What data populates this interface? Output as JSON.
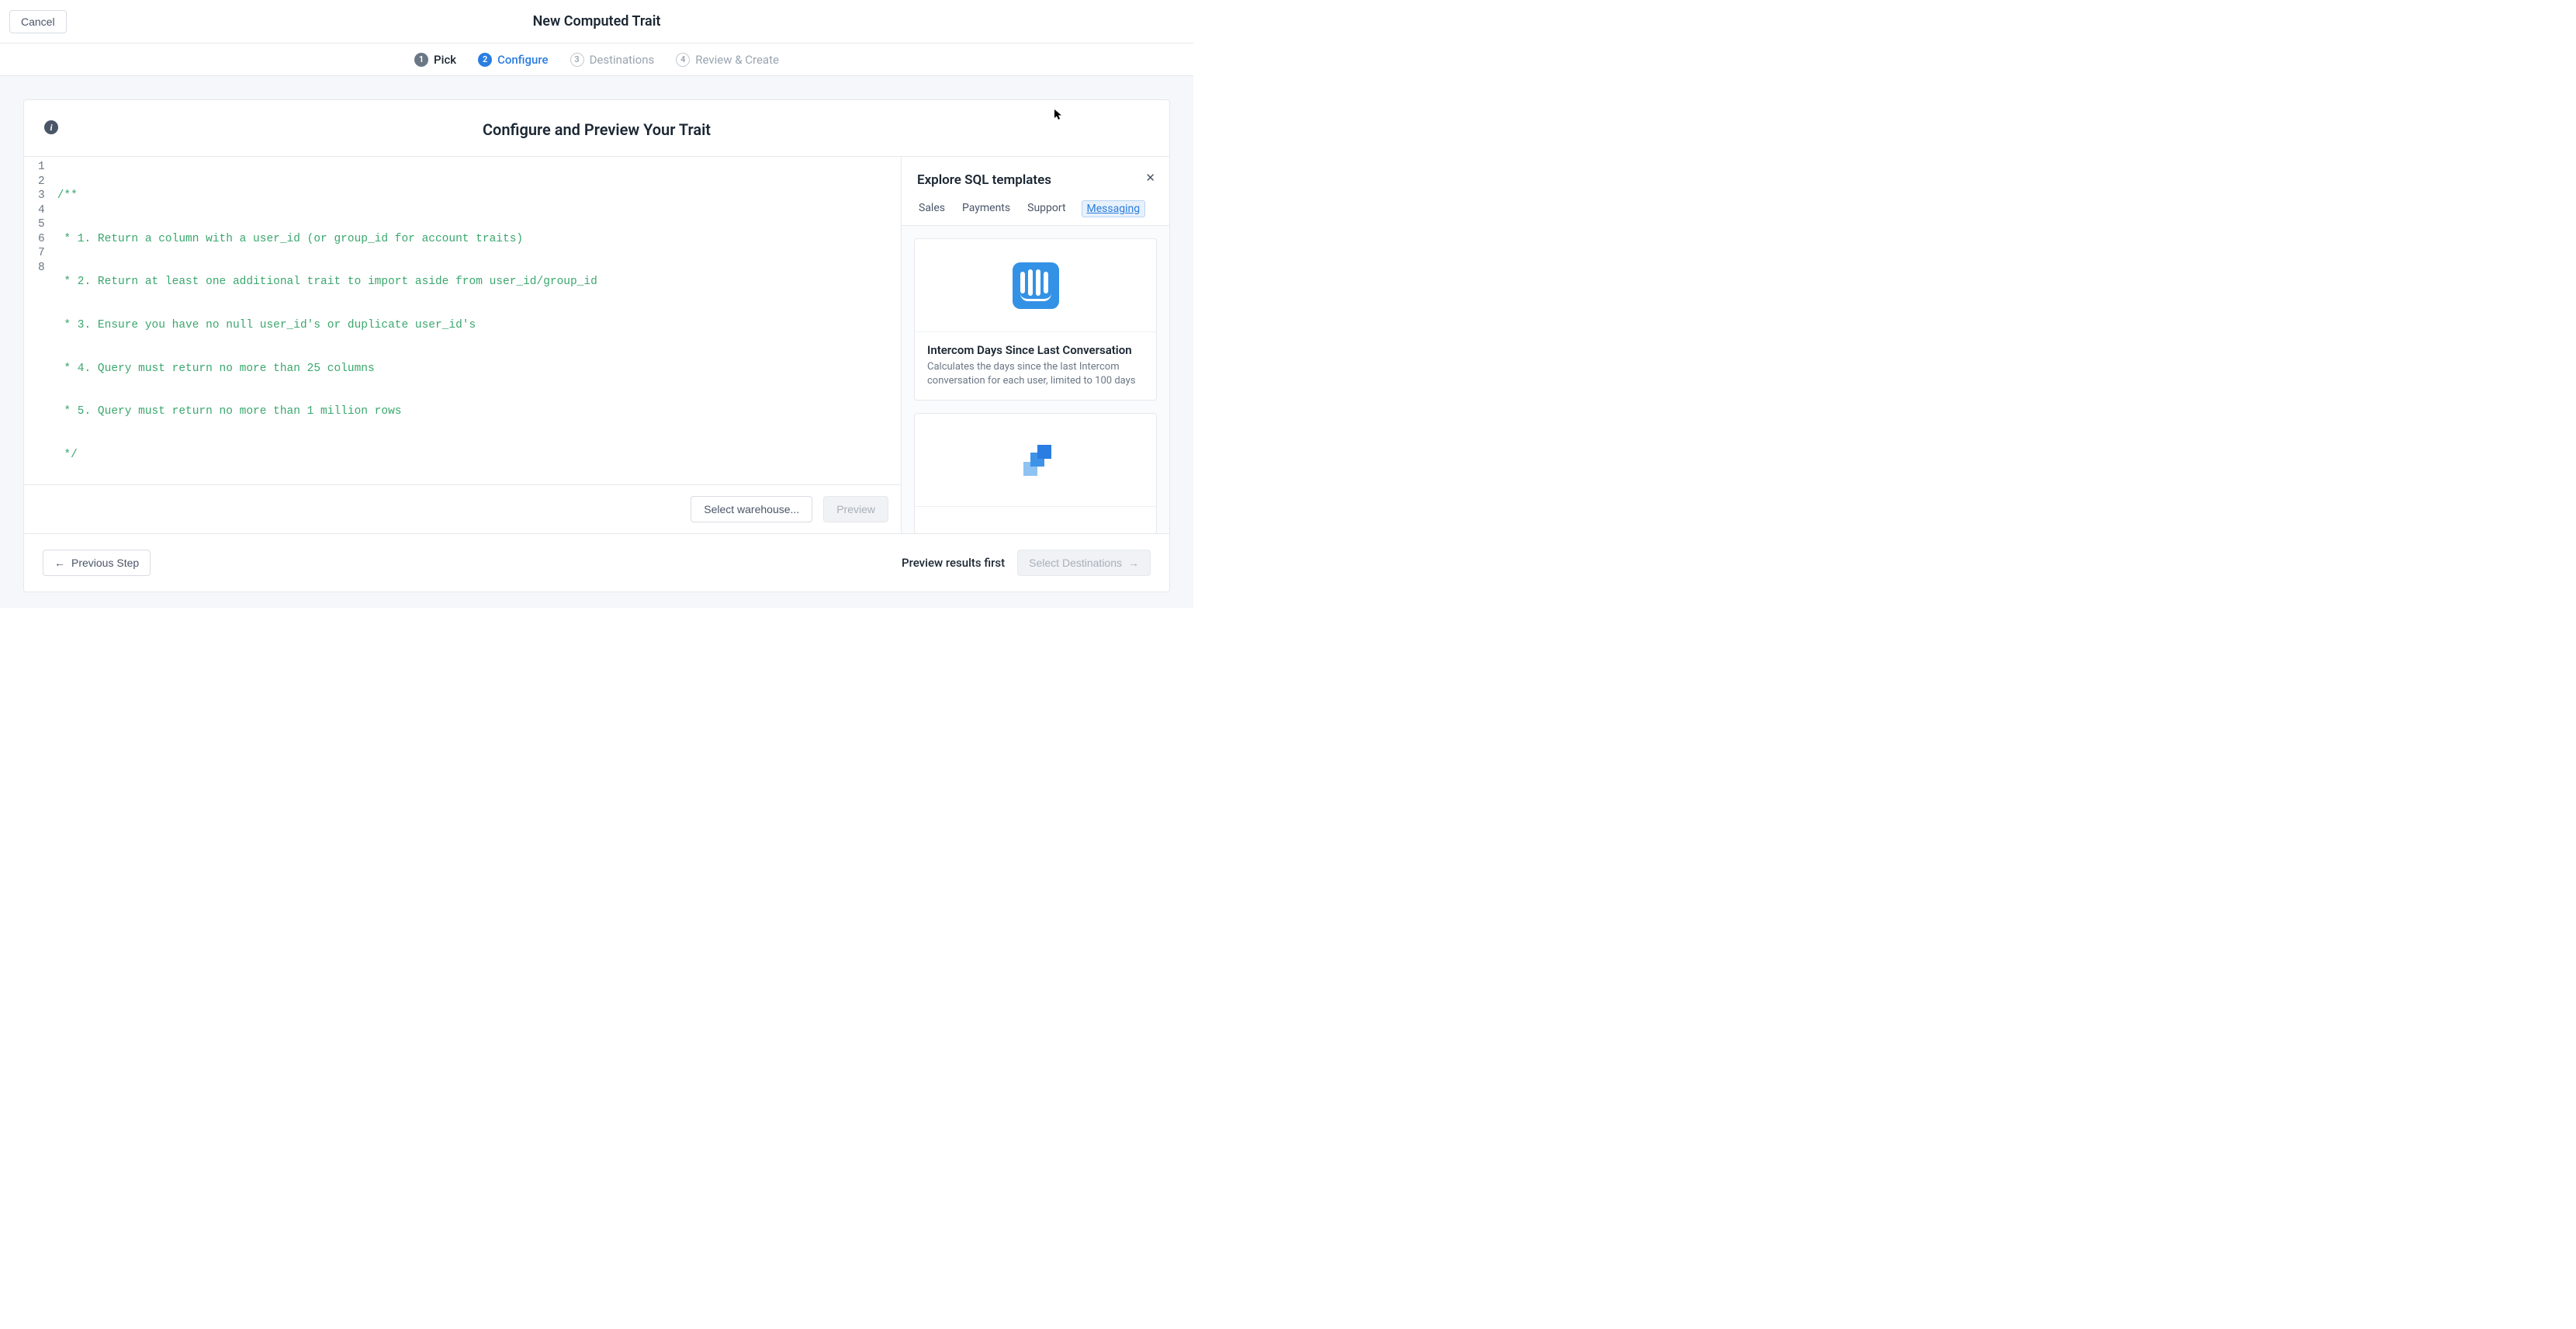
{
  "header": {
    "cancel_label": "Cancel",
    "title": "New Computed Trait"
  },
  "stepper": {
    "steps": [
      {
        "num": "1",
        "label": "Pick",
        "state": "done"
      },
      {
        "num": "2",
        "label": "Configure",
        "state": "active"
      },
      {
        "num": "3",
        "label": "Destinations",
        "state": "future"
      },
      {
        "num": "4",
        "label": "Review & Create",
        "state": "future"
      }
    ]
  },
  "panel": {
    "title": "Configure and Preview Your Trait",
    "info_icon": "i"
  },
  "editor": {
    "lines": [
      "/**",
      " * 1. Return a column with a user_id (or group_id for account traits)",
      " * 2. Return at least one additional trait to import aside from user_id/group_id",
      " * 3. Ensure you have no null user_id's or duplicate user_id's",
      " * 4. Query must return no more than 25 columns",
      " * 5. Query must return no more than 1 million rows",
      " */",
      ""
    ],
    "line_numbers": [
      "1",
      "2",
      "3",
      "4",
      "5",
      "6",
      "7",
      "8"
    ],
    "select_warehouse_label": "Select warehouse...",
    "preview_label": "Preview"
  },
  "side": {
    "title": "Explore SQL templates",
    "tabs": [
      "Sales",
      "Payments",
      "Support",
      "Messaging"
    ],
    "active_tab": "Messaging",
    "templates": [
      {
        "icon": "intercom",
        "title": "Intercom Days Since Last Conversation",
        "desc": "Calculates the days since the last Intercom conversation for each user, limited to 100 days"
      },
      {
        "icon": "sendgrid",
        "title": "",
        "desc": ""
      }
    ]
  },
  "wizard": {
    "previous_label": "Previous Step",
    "hint": "Preview results first",
    "next_label": "Select Destinations"
  }
}
